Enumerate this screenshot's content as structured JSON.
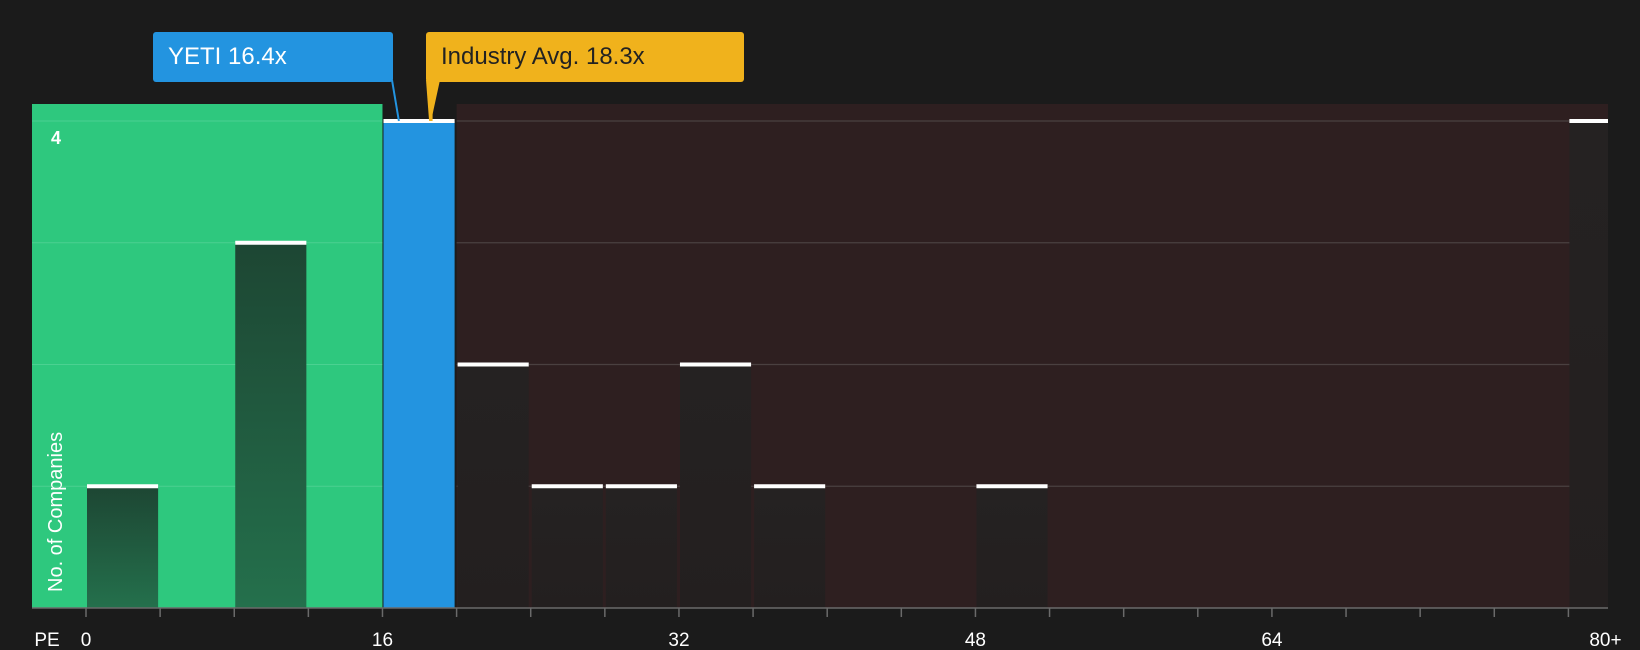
{
  "colors": {
    "background": "#1b1b1b",
    "below_region": "#2ec87e",
    "above_region": "#2e1f20",
    "company_bar": "#2394e0",
    "industry_marker": "#f0b21c",
    "bar_fill_below": "#1f4a36",
    "bar_fill_above": "#252121",
    "bar_cap": "#ffffff",
    "gridline": "#4a4040"
  },
  "callouts": {
    "company": {
      "label": "YETI 16.4x",
      "value": 16.4
    },
    "industry": {
      "label": "Industry Avg. 18.3x",
      "value": 18.3
    }
  },
  "chart_data": {
    "type": "bar",
    "xlabel": "PE",
    "ylabel": "No. of Companies",
    "x_ticks": [
      {
        "value": 0,
        "label": "0"
      },
      {
        "value": 16,
        "label": "16"
      },
      {
        "value": 32,
        "label": "32"
      },
      {
        "value": 48,
        "label": "48"
      },
      {
        "value": 64,
        "label": "64"
      },
      {
        "value": 82,
        "label": "80+"
      }
    ],
    "xlim": [
      -2.9,
      82
    ],
    "ylim": [
      0,
      4
    ],
    "y_tick_label": "4",
    "grid": true,
    "bin_width": 4,
    "bins": [
      {
        "x0": 0,
        "count": 1
      },
      {
        "x0": 8,
        "count": 3
      },
      {
        "x0": 16,
        "count": 4,
        "company": true
      },
      {
        "x0": 20,
        "count": 2
      },
      {
        "x0": 24,
        "count": 1
      },
      {
        "x0": 28,
        "count": 1
      },
      {
        "x0": 32,
        "count": 2
      },
      {
        "x0": 36,
        "count": 1
      },
      {
        "x0": 48,
        "count": 1
      },
      {
        "x0": 80,
        "count": 4,
        "overflow": true
      }
    ],
    "company_value": 16.4,
    "industry_avg": 18.3
  }
}
